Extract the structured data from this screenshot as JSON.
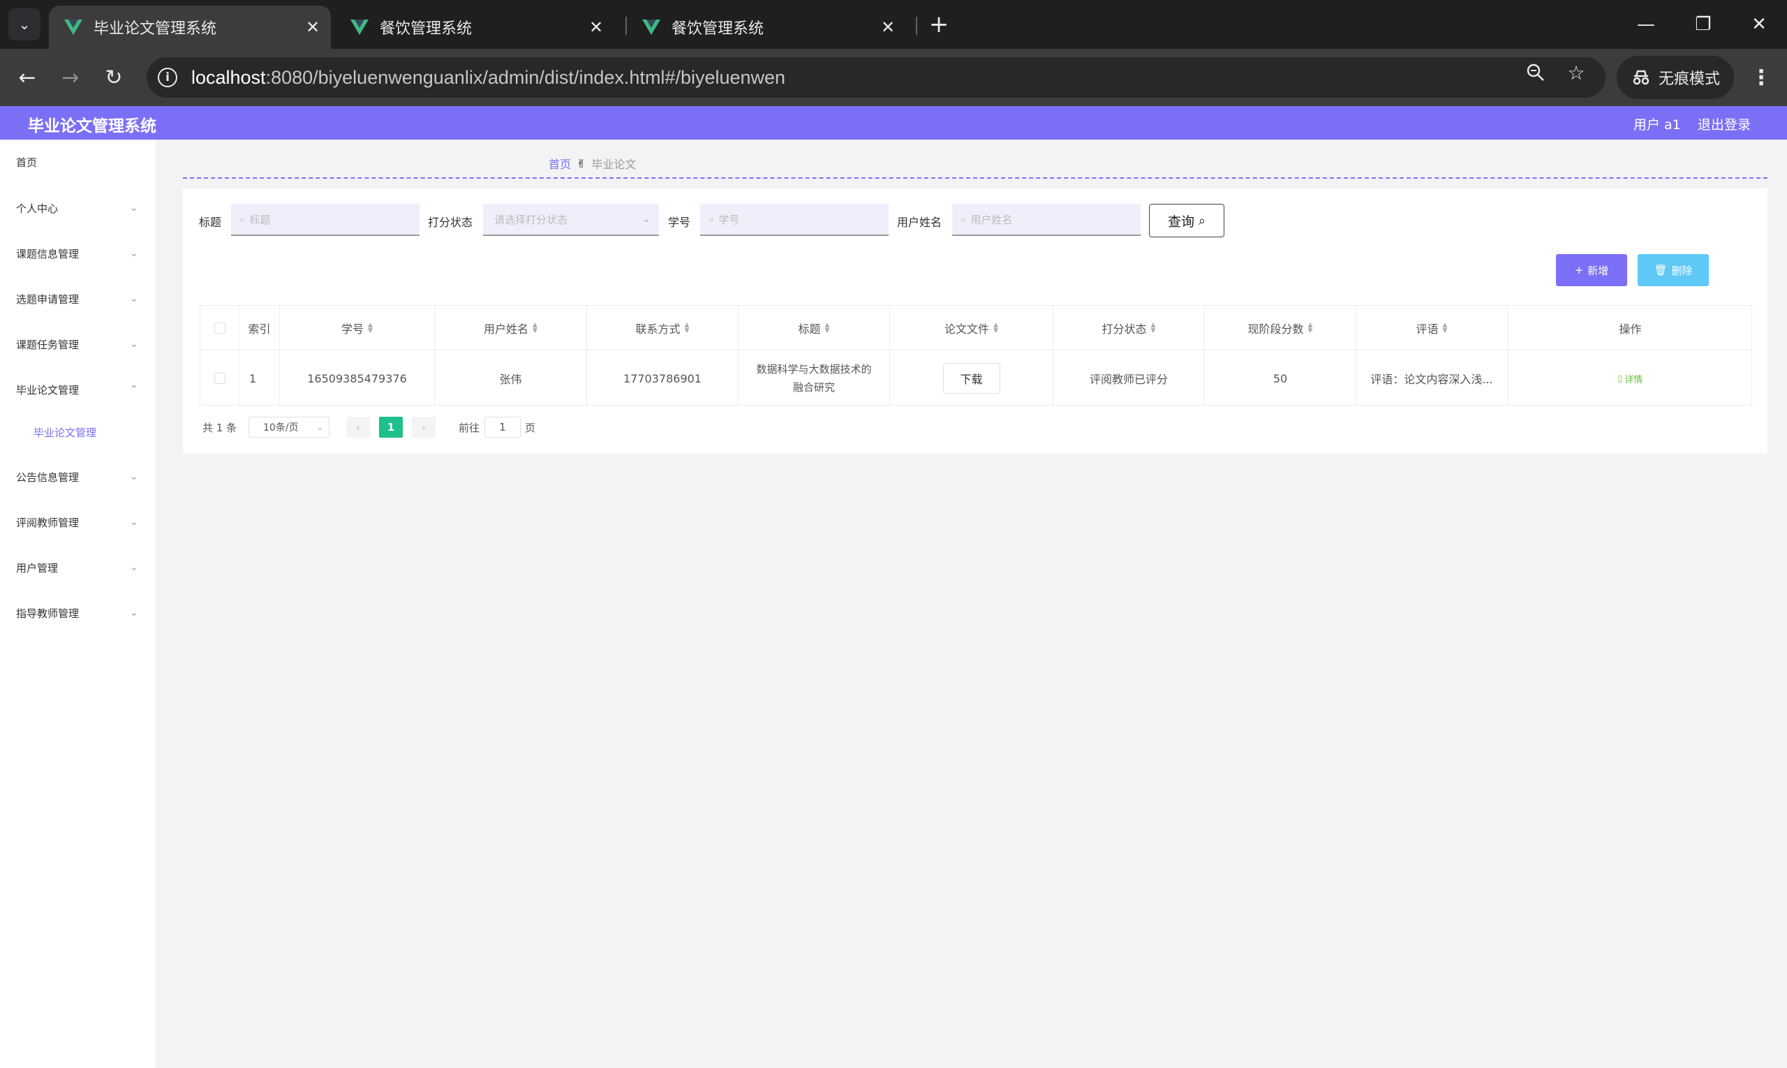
{
  "browser": {
    "tabs": [
      {
        "title": "毕业论文管理系统",
        "active": true
      },
      {
        "title": "餐饮管理系统",
        "active": false
      },
      {
        "title": "餐饮管理系统",
        "active": false
      }
    ],
    "url_host": "localhost",
    "url_path": ":8080/biyeluenwenguanlix/admin/dist/index.html#/biyeluenwen",
    "incognito_label": "无痕模式",
    "accent": "#7b70f5"
  },
  "header": {
    "title": "毕业论文管理系统",
    "user": "用户 a1",
    "logout": "退出登录"
  },
  "sidebar": {
    "items": [
      {
        "label": "首页"
      },
      {
        "label": "个人中心"
      },
      {
        "label": "课题信息管理"
      },
      {
        "label": "选题申请管理"
      },
      {
        "label": "课题任务管理"
      },
      {
        "label": "毕业论文管理"
      },
      {
        "label": "公告信息管理"
      },
      {
        "label": "评阅教师管理"
      },
      {
        "label": "用户管理"
      },
      {
        "label": "指导教师管理"
      }
    ],
    "sub_item": "毕业论文管理"
  },
  "breadcrumb": {
    "home": "首页",
    "current": "毕业论文"
  },
  "search": {
    "title_label": "标题",
    "title_placeholder": "标题",
    "status_label": "打分状态",
    "status_placeholder": "请选择打分状态",
    "id_label": "学号",
    "id_placeholder": "学号",
    "name_label": "用户姓名",
    "name_placeholder": "用户姓名",
    "query": "查询"
  },
  "actions": {
    "add": "新增",
    "delete": "删除"
  },
  "table": {
    "headers": [
      "索引",
      "学号",
      "用户姓名",
      "联系方式",
      "标题",
      "论文文件",
      "打分状态",
      "现阶段分数",
      "评语",
      "操作"
    ],
    "rows": [
      {
        "index": "1",
        "student_id": "16509385479376",
        "name": "张伟",
        "phone": "17703786901",
        "title_line1": "数据科学与大数据技术的",
        "title_line2": "融合研究",
        "file_button": "下载",
        "status": "评阅教师已评分",
        "score": "50",
        "comment": "评语：论文内容深入浅...",
        "detail": "详情"
      }
    ]
  },
  "pagination": {
    "total": "共 1 条",
    "page_size": "10条/页",
    "current_page": "1",
    "goto_label": "前往",
    "goto_value": "1",
    "page_suffix": "页"
  }
}
